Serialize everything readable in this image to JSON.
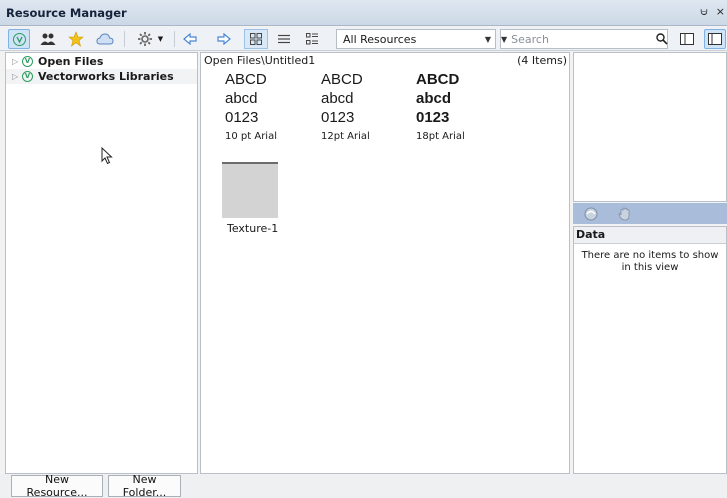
{
  "window": {
    "title": "Resource Manager",
    "pin_glyph": "⩁",
    "close_glyph": "×"
  },
  "toolbar": {
    "filter_combo": {
      "value": "All Resources"
    },
    "search": {
      "placeholder": "Search"
    }
  },
  "tree": {
    "items": [
      {
        "label": "Open Files",
        "logo": "V"
      },
      {
        "label": "Vectorworks Libraries",
        "logo": "V"
      }
    ]
  },
  "content": {
    "path": "Open Files\\Untitled1",
    "count": "(4 Items)",
    "font_resources": [
      {
        "line1": "ABCD",
        "line2": "abcd",
        "line3": "0123",
        "label": "10 pt Arial"
      },
      {
        "line1": "ABCD",
        "line2": "abcd",
        "line3": "0123",
        "label": "12pt Arial"
      },
      {
        "line1": "ABCD",
        "line2": "abcd",
        "line3": "0123",
        "label": "18pt Arial"
      }
    ],
    "texture": {
      "label": "Texture-1"
    }
  },
  "data_panel": {
    "title": "Data",
    "empty_message": "There are no items to show in this view"
  },
  "footer": {
    "new_resource": "New Resource...",
    "new_folder": "New Folder..."
  },
  "colors": {
    "accent_green": "#2d9c5f",
    "nav_blue": "#4a86d4",
    "star_yellow": "#f2c21b",
    "preview_toolbar": "#a9bcd9"
  }
}
